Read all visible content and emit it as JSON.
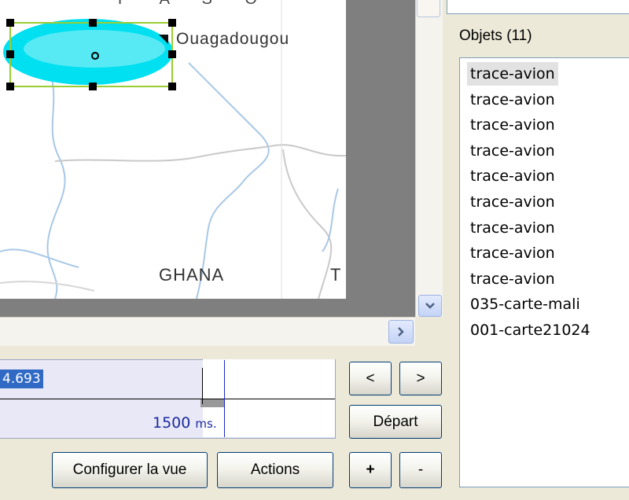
{
  "map": {
    "labels": {
      "burkina": "F A S O",
      "city": "Ouagadougou",
      "ghana": "GHANA",
      "togo": "T"
    }
  },
  "scrollbars": {
    "down_glyph": "⌄",
    "right_glyph": ">"
  },
  "timeline": {
    "current_value": "4.693",
    "time_value": "1500",
    "time_unit": "ms."
  },
  "buttons": {
    "prev": "<",
    "next": ">",
    "depart": "Départ",
    "configure_view": "Configurer la vue",
    "actions": "Actions",
    "plus": "+",
    "minus": "-"
  },
  "objects_panel": {
    "heading": "Objets (11)",
    "items": [
      "trace-avion",
      "trace-avion",
      "trace-avion",
      "trace-avion",
      "trace-avion",
      "trace-avion",
      "trace-avion",
      "trace-avion",
      "trace-avion",
      "035-carte-mali",
      "001-carte21024"
    ]
  },
  "colors": {
    "map_ellipse": "#00e0f0",
    "selection_handles": "#000000",
    "selection_frame": "#9acd32",
    "highlight": "#316ac5"
  }
}
